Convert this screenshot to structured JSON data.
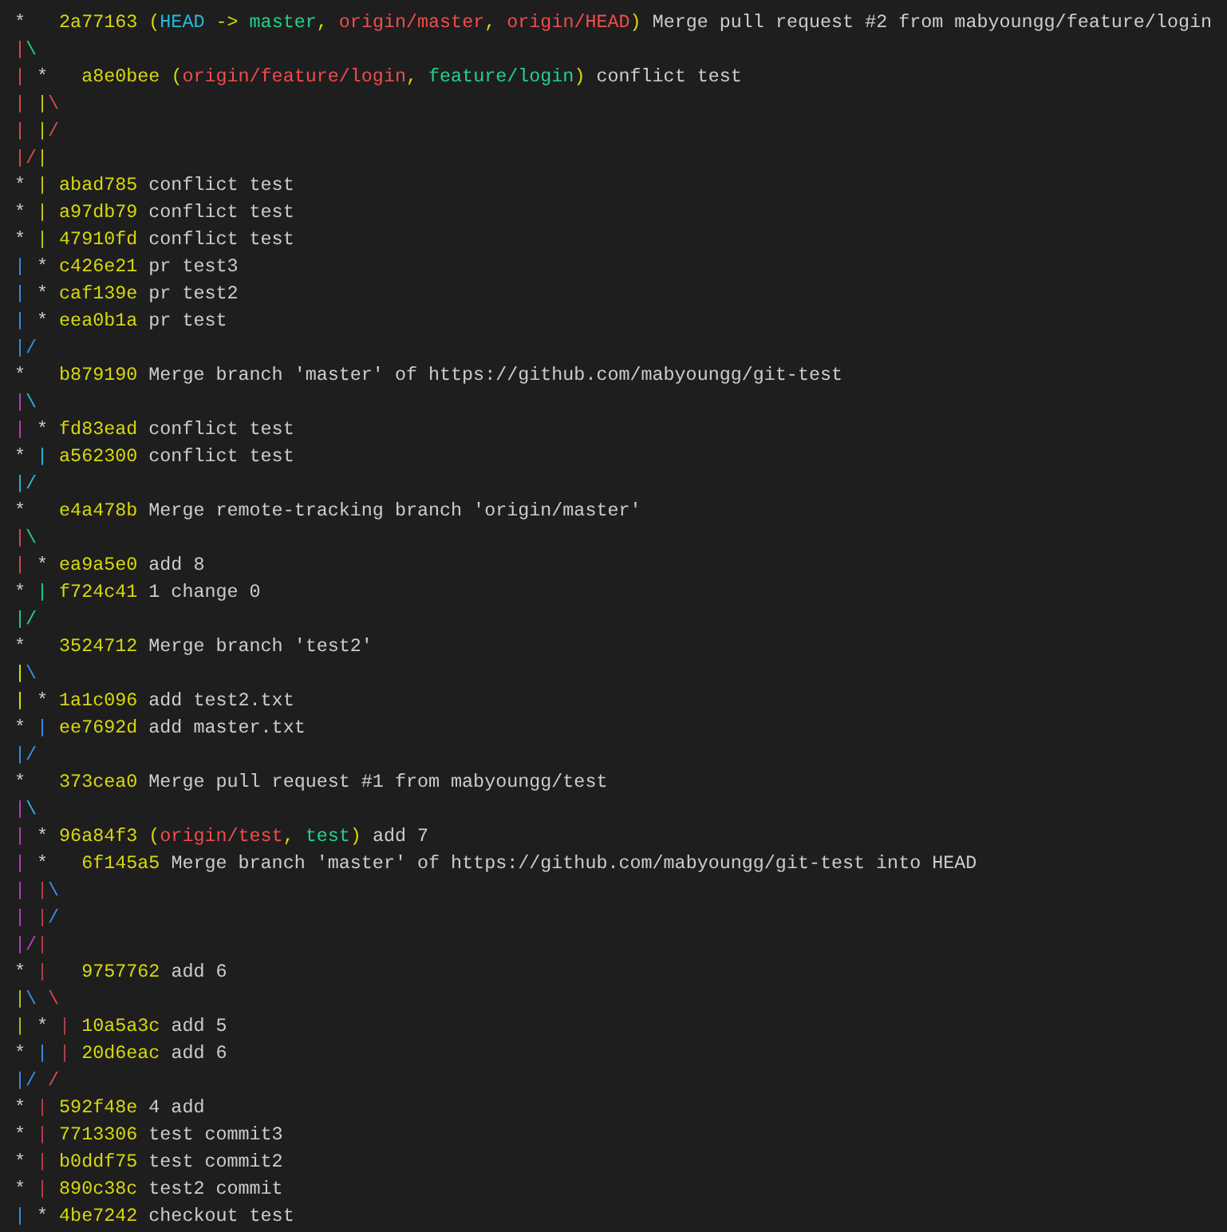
{
  "terminal": {
    "lines": [
      {
        "graph": [
          {
            "kind": "node",
            "text": "*  "
          }
        ],
        "hash": "2a77163",
        "refs": [
          {
            "kind": "punct",
            "text": "("
          },
          {
            "kind": "head",
            "text": "HEAD"
          },
          {
            "kind": "punct",
            "text": " -> "
          },
          {
            "kind": "local",
            "text": "master"
          },
          {
            "kind": "punct",
            "text": ", "
          },
          {
            "kind": "remote",
            "text": "origin/master"
          },
          {
            "kind": "punct",
            "text": ", "
          },
          {
            "kind": "remote",
            "text": "origin/HEAD"
          },
          {
            "kind": "punct",
            "text": ")"
          }
        ],
        "message": "Merge pull request #2 from mabyoungg/feature/login"
      },
      {
        "graph": [
          {
            "kind": "edge",
            "text": "|",
            "color": "#d94c4c"
          },
          {
            "kind": "edge",
            "text": "\\",
            "color": "#23d18b"
          }
        ]
      },
      {
        "graph": [
          {
            "kind": "edge",
            "text": "|",
            "color": "#d94c4c"
          },
          {
            "kind": "node",
            "text": " *  "
          }
        ],
        "hash": "a8e0bee",
        "refs": [
          {
            "kind": "punct",
            "text": "("
          },
          {
            "kind": "remote",
            "text": "origin/feature/login"
          },
          {
            "kind": "punct",
            "text": ", "
          },
          {
            "kind": "local",
            "text": "feature/login"
          },
          {
            "kind": "punct",
            "text": ")"
          }
        ],
        "message": "conflict test"
      },
      {
        "graph": [
          {
            "kind": "edge",
            "text": "|",
            "color": "#d94c4c"
          },
          {
            "kind": "edge",
            "text": " |",
            "color": "#c8c81a"
          },
          {
            "kind": "edge",
            "text": "\\",
            "color": "#d94c4c"
          }
        ]
      },
      {
        "graph": [
          {
            "kind": "edge",
            "text": "|",
            "color": "#d94c4c"
          },
          {
            "kind": "edge",
            "text": " |",
            "color": "#c8c81a"
          },
          {
            "kind": "edge",
            "text": "/",
            "color": "#d94c4c"
          }
        ]
      },
      {
        "graph": [
          {
            "kind": "edge",
            "text": "|",
            "color": "#d94c4c"
          },
          {
            "kind": "edge",
            "text": "/",
            "color": "#d94c4c"
          },
          {
            "kind": "edge",
            "text": "|",
            "color": "#c8c81a"
          }
        ]
      },
      {
        "graph": [
          {
            "kind": "node",
            "text": "*"
          },
          {
            "kind": "edge",
            "text": " |",
            "color": "#c8c81a"
          }
        ],
        "hash": "abad785",
        "message": "conflict test"
      },
      {
        "graph": [
          {
            "kind": "node",
            "text": "*"
          },
          {
            "kind": "edge",
            "text": " |",
            "color": "#c8c81a"
          }
        ],
        "hash": "a97db79",
        "message": "conflict test"
      },
      {
        "graph": [
          {
            "kind": "node",
            "text": "*"
          },
          {
            "kind": "edge",
            "text": " |",
            "color": "#c8c81a"
          }
        ],
        "hash": "47910fd",
        "message": "conflict test"
      },
      {
        "graph": [
          {
            "kind": "edge",
            "text": "|",
            "color": "#3b8eea"
          },
          {
            "kind": "node",
            "text": " *"
          }
        ],
        "hash": "c426e21",
        "message": "pr test3"
      },
      {
        "graph": [
          {
            "kind": "edge",
            "text": "|",
            "color": "#3b8eea"
          },
          {
            "kind": "node",
            "text": " *"
          }
        ],
        "hash": "caf139e",
        "message": "pr test2"
      },
      {
        "graph": [
          {
            "kind": "edge",
            "text": "|",
            "color": "#3b8eea"
          },
          {
            "kind": "node",
            "text": " *"
          }
        ],
        "hash": "eea0b1a",
        "message": "pr test"
      },
      {
        "graph": [
          {
            "kind": "edge",
            "text": "|",
            "color": "#3b8eea"
          },
          {
            "kind": "edge",
            "text": "/",
            "color": "#3b8eea"
          }
        ]
      },
      {
        "graph": [
          {
            "kind": "node",
            "text": "*  "
          }
        ],
        "hash": "b879190",
        "message": "Merge branch 'master' of https://github.com/mabyoungg/git-test"
      },
      {
        "graph": [
          {
            "kind": "edge",
            "text": "|",
            "color": "#bc3fbc"
          },
          {
            "kind": "edge",
            "text": "\\",
            "color": "#29b8db"
          }
        ]
      },
      {
        "graph": [
          {
            "kind": "edge",
            "text": "|",
            "color": "#bc3fbc"
          },
          {
            "kind": "node",
            "text": " *"
          }
        ],
        "hash": "fd83ead",
        "message": "conflict test"
      },
      {
        "graph": [
          {
            "kind": "node",
            "text": "*"
          },
          {
            "kind": "edge",
            "text": " |",
            "color": "#29b8db"
          }
        ],
        "hash": "a562300",
        "message": "conflict test"
      },
      {
        "graph": [
          {
            "kind": "edge",
            "text": "|",
            "color": "#29b8db"
          },
          {
            "kind": "edge",
            "text": "/",
            "color": "#29b8db"
          }
        ]
      },
      {
        "graph": [
          {
            "kind": "node",
            "text": "*  "
          }
        ],
        "hash": "e4a478b",
        "message": "Merge remote-tracking branch 'origin/master'"
      },
      {
        "graph": [
          {
            "kind": "edge",
            "text": "|",
            "color": "#d94c4c"
          },
          {
            "kind": "edge",
            "text": "\\",
            "color": "#23d18b"
          }
        ]
      },
      {
        "graph": [
          {
            "kind": "edge",
            "text": "|",
            "color": "#d94c4c"
          },
          {
            "kind": "node",
            "text": " *"
          }
        ],
        "hash": "ea9a5e0",
        "message": "add 8"
      },
      {
        "graph": [
          {
            "kind": "node",
            "text": "*"
          },
          {
            "kind": "edge",
            "text": " |",
            "color": "#23d18b"
          }
        ],
        "hash": "f724c41",
        "message": "1 change 0"
      },
      {
        "graph": [
          {
            "kind": "edge",
            "text": "|",
            "color": "#23d18b"
          },
          {
            "kind": "edge",
            "text": "/",
            "color": "#23d18b"
          }
        ]
      },
      {
        "graph": [
          {
            "kind": "node",
            "text": "*  "
          }
        ],
        "hash": "3524712",
        "message": "Merge branch 'test2'"
      },
      {
        "graph": [
          {
            "kind": "edge",
            "text": "|",
            "color": "#e5e510"
          },
          {
            "kind": "edge",
            "text": "\\",
            "color": "#3b8eea"
          }
        ]
      },
      {
        "graph": [
          {
            "kind": "edge",
            "text": "|",
            "color": "#e5e510"
          },
          {
            "kind": "node",
            "text": " *"
          }
        ],
        "hash": "1a1c096",
        "message": "add test2.txt"
      },
      {
        "graph": [
          {
            "kind": "node",
            "text": "*"
          },
          {
            "kind": "edge",
            "text": " |",
            "color": "#3b8eea"
          }
        ],
        "hash": "ee7692d",
        "message": "add master.txt"
      },
      {
        "graph": [
          {
            "kind": "edge",
            "text": "|",
            "color": "#3b8eea"
          },
          {
            "kind": "edge",
            "text": "/",
            "color": "#3b8eea"
          }
        ]
      },
      {
        "graph": [
          {
            "kind": "node",
            "text": "*  "
          }
        ],
        "hash": "373cea0",
        "message": "Merge pull request #1 from mabyoungg/test"
      },
      {
        "graph": [
          {
            "kind": "edge",
            "text": "|",
            "color": "#bc3fbc"
          },
          {
            "kind": "edge",
            "text": "\\",
            "color": "#29b8db"
          }
        ]
      },
      {
        "graph": [
          {
            "kind": "edge",
            "text": "|",
            "color": "#bc3fbc"
          },
          {
            "kind": "node",
            "text": " *"
          }
        ],
        "hash": "96a84f3",
        "refs": [
          {
            "kind": "punct",
            "text": "("
          },
          {
            "kind": "remote",
            "text": "origin/test"
          },
          {
            "kind": "punct",
            "text": ", "
          },
          {
            "kind": "local",
            "text": "test"
          },
          {
            "kind": "punct",
            "text": ")"
          }
        ],
        "message": "add 7"
      },
      {
        "graph": [
          {
            "kind": "edge",
            "text": "|",
            "color": "#bc3fbc"
          },
          {
            "kind": "node",
            "text": " *  "
          }
        ],
        "hash": "6f145a5",
        "message": "Merge branch 'master' of https://github.com/mabyoungg/git-test into HEAD"
      },
      {
        "graph": [
          {
            "kind": "edge",
            "text": "|",
            "color": "#bc3fbc"
          },
          {
            "kind": "edge",
            "text": " |",
            "color": "#b8404a"
          },
          {
            "kind": "edge",
            "text": "\\",
            "color": "#3b8eea"
          }
        ]
      },
      {
        "graph": [
          {
            "kind": "edge",
            "text": "|",
            "color": "#bc3fbc"
          },
          {
            "kind": "edge",
            "text": " |",
            "color": "#b8404a"
          },
          {
            "kind": "edge",
            "text": "/",
            "color": "#3b8eea"
          }
        ]
      },
      {
        "graph": [
          {
            "kind": "edge",
            "text": "|",
            "color": "#bc3fbc"
          },
          {
            "kind": "edge",
            "text": "/",
            "color": "#bc3fbc"
          },
          {
            "kind": "edge",
            "text": "|",
            "color": "#b8404a"
          }
        ]
      },
      {
        "graph": [
          {
            "kind": "node",
            "text": "*"
          },
          {
            "kind": "edge",
            "text": " |  ",
            "color": "#b8404a"
          }
        ],
        "hash": "9757762",
        "message": "add 6"
      },
      {
        "graph": [
          {
            "kind": "edge",
            "text": "|",
            "color": "#b5c81a"
          },
          {
            "kind": "edge",
            "text": "\\",
            "color": "#3b8eea"
          },
          {
            "kind": "edge",
            "text": " \\",
            "color": "#d94c4c"
          }
        ]
      },
      {
        "graph": [
          {
            "kind": "edge",
            "text": "|",
            "color": "#b5c81a"
          },
          {
            "kind": "node",
            "text": " *"
          },
          {
            "kind": "edge",
            "text": " |",
            "color": "#b8404a"
          }
        ],
        "hash": "10a5a3c",
        "message": "add 5"
      },
      {
        "graph": [
          {
            "kind": "node",
            "text": "*"
          },
          {
            "kind": "edge",
            "text": " |",
            "color": "#3b8eea"
          },
          {
            "kind": "edge",
            "text": " |",
            "color": "#b8404a"
          }
        ],
        "hash": "20d6eac",
        "message": "add 6"
      },
      {
        "graph": [
          {
            "kind": "edge",
            "text": "|",
            "color": "#3b8eea"
          },
          {
            "kind": "edge",
            "text": "/",
            "color": "#3b8eea"
          },
          {
            "kind": "edge",
            "text": " /",
            "color": "#d94c4c"
          }
        ]
      },
      {
        "graph": [
          {
            "kind": "node",
            "text": "*"
          },
          {
            "kind": "edge",
            "text": " |",
            "color": "#b8404a"
          }
        ],
        "hash": "592f48e",
        "message": "4 add"
      },
      {
        "graph": [
          {
            "kind": "node",
            "text": "*"
          },
          {
            "kind": "edge",
            "text": " |",
            "color": "#b8404a"
          }
        ],
        "hash": "7713306",
        "message": "test commit3"
      },
      {
        "graph": [
          {
            "kind": "node",
            "text": "*"
          },
          {
            "kind": "edge",
            "text": " |",
            "color": "#b8404a"
          }
        ],
        "hash": "b0ddf75",
        "message": "test commit2"
      },
      {
        "graph": [
          {
            "kind": "node",
            "text": "*"
          },
          {
            "kind": "edge",
            "text": " |",
            "color": "#b8404a"
          }
        ],
        "hash": "890c38c",
        "message": "test2 commit"
      },
      {
        "graph": [
          {
            "kind": "edge",
            "text": "|",
            "color": "#3b8eea"
          },
          {
            "kind": "node",
            "text": " *"
          }
        ],
        "hash": "4be7242",
        "message": "checkout test"
      }
    ]
  }
}
